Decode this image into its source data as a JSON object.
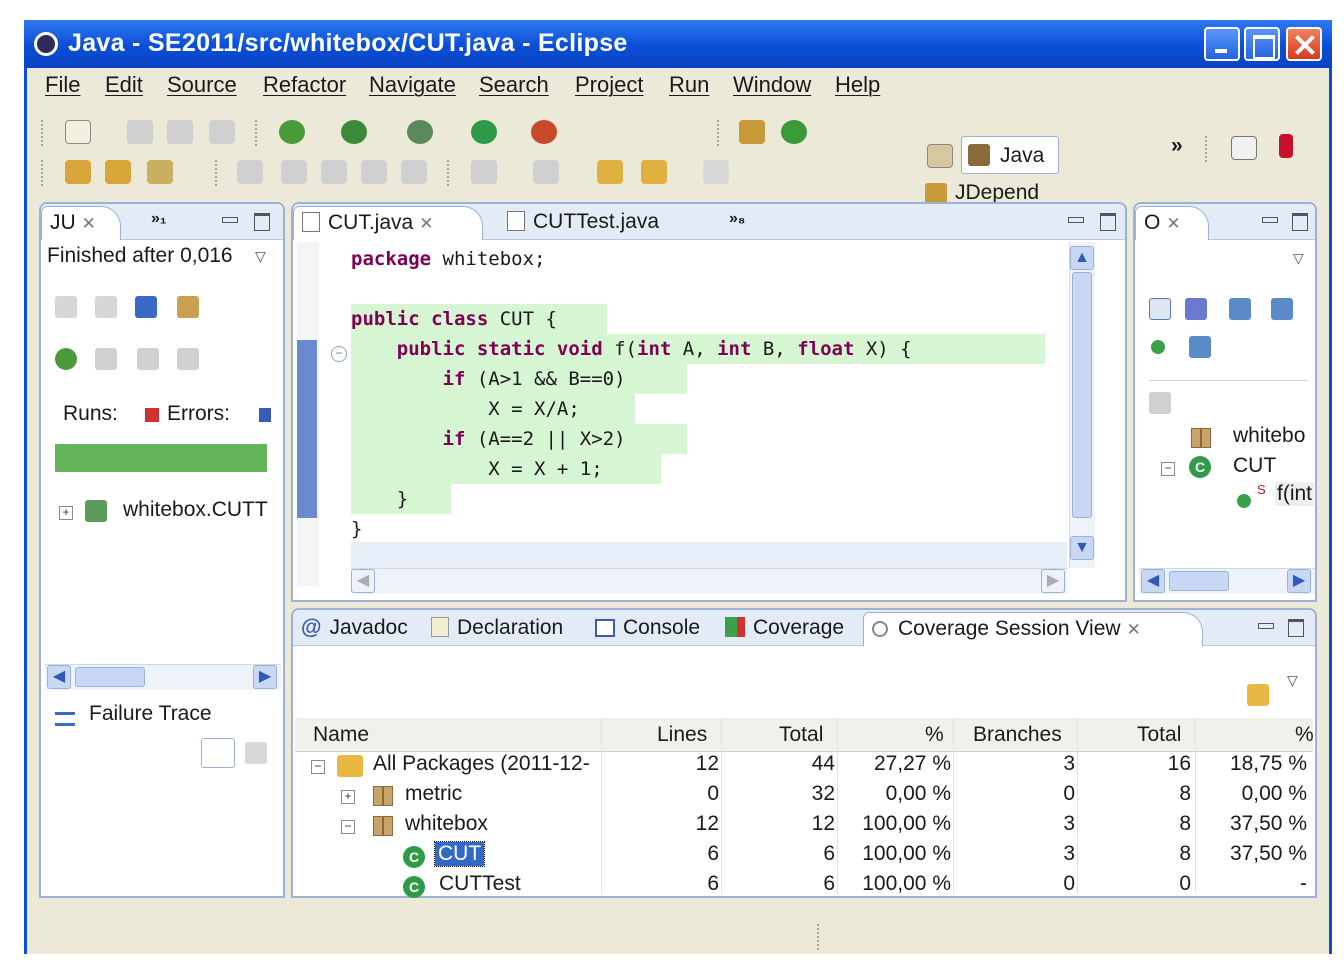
{
  "window": {
    "title": "Java - SE2011/src/whitebox/CUT.java - Eclipse"
  },
  "menu": [
    "File",
    "Edit",
    "Source",
    "Refactor",
    "Navigate",
    "Search",
    "Project",
    "Run",
    "Window",
    "Help"
  ],
  "perspectives": {
    "java": "Java",
    "jdepend": "JDepend",
    "more": "»"
  },
  "junit": {
    "tab_label": "JU",
    "overflow": "»₁",
    "status": "Finished after 0,016",
    "runs_label": "Runs:",
    "errors_label": "Errors:",
    "progress_color": "#62b55a",
    "tree_item": "whitebox.CUTT",
    "failure_trace": "Failure Trace"
  },
  "editor": {
    "tabs": [
      "CUT.java",
      "CUTTest.java"
    ],
    "overflow": "»₈",
    "lines": [
      {
        "kw": "package",
        "rest": " whitebox;"
      },
      {
        "kw": "",
        "rest": ""
      },
      {
        "kw": "public class",
        "rest": " CUT {"
      },
      {
        "indent": "    ",
        "kw": "public static void",
        "rest": " f(",
        "kw2": "int",
        "rest2": " A, ",
        "kw3": "int",
        "rest3": " B, ",
        "kw4": "float",
        "rest4": " X) {"
      },
      {
        "indent": "        ",
        "kw": "if",
        "rest": " (A>1 && B==0)"
      },
      {
        "indent": "            ",
        "kw": "",
        "rest": "X = X/A;"
      },
      {
        "indent": "        ",
        "kw": "if",
        "rest": " (A==2 || X>2)"
      },
      {
        "indent": "            ",
        "kw": "",
        "rest": "X = X + 1;"
      },
      {
        "indent": "    ",
        "kw": "",
        "rest": "}"
      },
      {
        "kw": "",
        "rest": "}"
      }
    ],
    "coverage_color": "#d6f5d2"
  },
  "outline": {
    "tab_label": "O",
    "items": [
      {
        "label": "whitebo"
      },
      {
        "label": "CUT"
      },
      {
        "label": "f(int"
      }
    ],
    "static_marker": "S"
  },
  "bottom_tabs": [
    "Javadoc",
    "Declaration",
    "Console",
    "Coverage",
    "Coverage Session View"
  ],
  "coverage_table": {
    "columns": [
      "Name",
      "Lines",
      "Total",
      "%",
      "Branches",
      "Total",
      "%"
    ],
    "rows": [
      {
        "name": "All Packages (2011-12-",
        "lines": "12",
        "total": "44",
        "pct": "27,27 %",
        "branches": "3",
        "btotal": "16",
        "bpct": "18,75 %"
      },
      {
        "name": "metric",
        "lines": "0",
        "total": "32",
        "pct": "0,00 %",
        "branches": "0",
        "btotal": "8",
        "bpct": "0,00 %"
      },
      {
        "name": "whitebox",
        "lines": "12",
        "total": "12",
        "pct": "100,00 %",
        "branches": "3",
        "btotal": "8",
        "bpct": "37,50 %"
      },
      {
        "name": "CUT",
        "lines": "6",
        "total": "6",
        "pct": "100,00 %",
        "branches": "3",
        "btotal": "8",
        "bpct": "37,50 %"
      },
      {
        "name": "CUTTest",
        "lines": "6",
        "total": "6",
        "pct": "100,00 %",
        "branches": "0",
        "btotal": "0",
        "bpct": "-"
      }
    ]
  },
  "colors": {
    "titlebar": "#0a4ed6",
    "view_border": "#9bb1d6",
    "selection": "#3169c6"
  }
}
